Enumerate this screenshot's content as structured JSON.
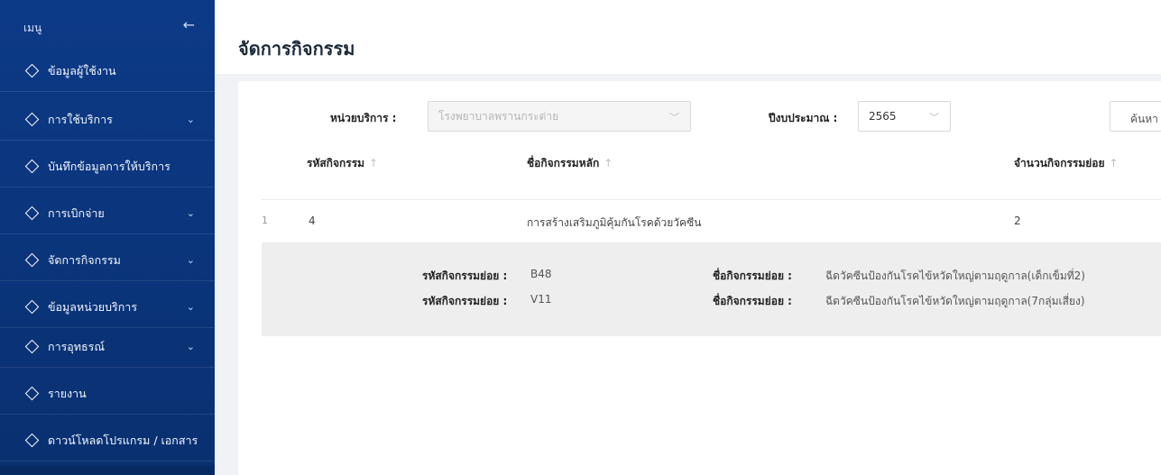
{
  "sidebar": {
    "title": "เมนู",
    "back_icon": "←",
    "items": [
      {
        "label": "ข้อมูลผู้ใช้งาน",
        "expandable": false
      },
      {
        "label": "การใช้บริการ",
        "expandable": true
      },
      {
        "label": "บันทึกข้อมูลการให้บริการ",
        "expandable": false
      },
      {
        "label": "การเบิกจ่าย",
        "expandable": true
      },
      {
        "label": "จัดการกิจกรรม",
        "expandable": true
      },
      {
        "label": "ข้อมูลหน่วยบริการ",
        "expandable": true
      },
      {
        "label": "การอุทธรณ์",
        "expandable": true
      },
      {
        "label": "รายงาน",
        "expandable": false
      },
      {
        "label": "ดาวน์โหลดโปรแกรม / เอกสาร",
        "expandable": false
      }
    ],
    "chevron": "⌄"
  },
  "page": {
    "title": "จัดการกิจกรรม"
  },
  "filters": {
    "unit_label": "หน่วยบริการ :",
    "unit_value": "โรงพยาบาลพรานกระต่าย",
    "year_label": "ปีงบประมาณ :",
    "year_value": "2565",
    "search_label": "ค้นหา",
    "arrow": "﹀"
  },
  "table": {
    "headers": {
      "code": "รหัสกิจกรรม",
      "name": "ชื่อกิจกรรมหลัก",
      "count": "จำนวนกิจกรรมย่อย"
    },
    "sort_icon": "↑",
    "rows": [
      {
        "index": "1",
        "code": "4",
        "name": "การสร้างเสริมภูมิคุ้มกันโรคด้วยวัคซีน",
        "count": "2"
      }
    ],
    "expanded": {
      "sub_code_label": "รหัสกิจกรรมย่อย :",
      "sub_name_label": "ชื่อกิจกรรมย่อย :",
      "items": [
        {
          "code": "B48",
          "name": "ฉีดวัคซีนป้องกันโรคไข้หวัดใหญ่ตามฤดูกาล(เด็กเข็มที่2)"
        },
        {
          "code": "V11",
          "name": "ฉีดวัคซีนป้องกันโรคไข้หวัดใหญ่ตามฤดูกาล(7กลุ่มเสี่ยง)"
        }
      ]
    }
  },
  "colors": {
    "sidebar_bg": "#0d3a87",
    "page_bg": "#f0f2f5",
    "expanded_bg": "#eeeeee"
  }
}
